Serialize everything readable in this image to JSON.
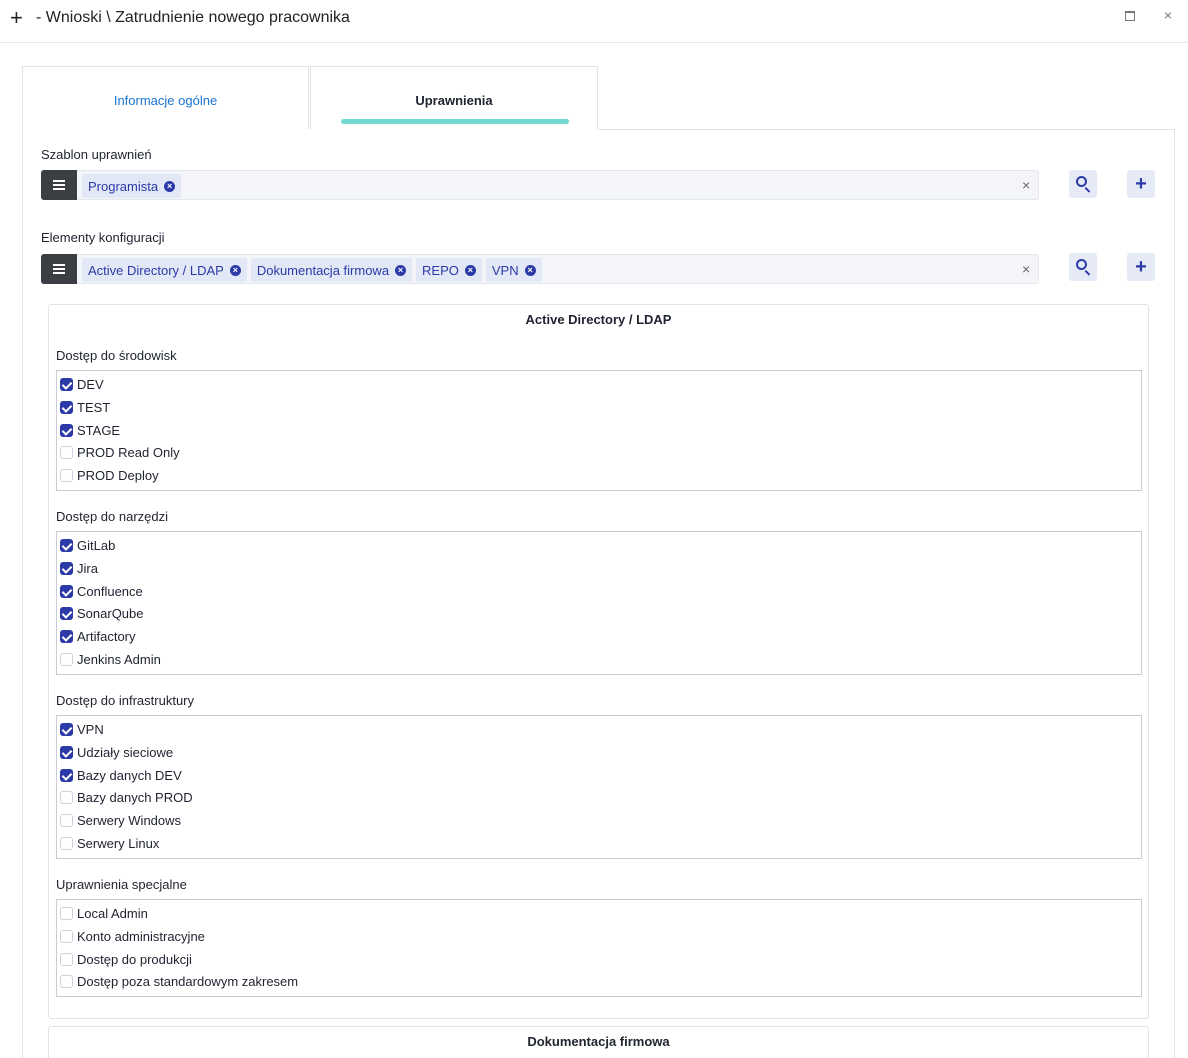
{
  "window": {
    "title": "- Wnioski \\ Zatrudnienie nowego pracownika",
    "plus_glyph": "+",
    "close_glyph": "×"
  },
  "tabs": [
    {
      "label": "Informacje ogólne",
      "active": false
    },
    {
      "label": "Uprawnienia",
      "active": true
    }
  ],
  "template_field": {
    "label": "Szablon uprawnień",
    "chips": [
      "Programista"
    ],
    "clear_glyph": "×"
  },
  "config_field": {
    "label": "Elementy konfiguracji",
    "chips": [
      "Active Directory / LDAP",
      "Dokumentacja firmowa",
      "REPO",
      "VPN"
    ],
    "clear_glyph": "×"
  },
  "button_glyphs": {
    "add": "+",
    "chip_remove": "×"
  },
  "sections": [
    {
      "title": "Active Directory / LDAP",
      "groups": [
        {
          "title": "Dostęp do środowisk",
          "items": [
            {
              "label": "DEV",
              "checked": true
            },
            {
              "label": "TEST",
              "checked": true
            },
            {
              "label": "STAGE",
              "checked": true
            },
            {
              "label": "PROD Read Only",
              "checked": false
            },
            {
              "label": "PROD Deploy",
              "checked": false
            }
          ]
        },
        {
          "title": "Dostęp do narzędzi",
          "items": [
            {
              "label": "GitLab",
              "checked": true
            },
            {
              "label": "Jira",
              "checked": true
            },
            {
              "label": "Confluence",
              "checked": true
            },
            {
              "label": "SonarQube",
              "checked": true
            },
            {
              "label": "Artifactory",
              "checked": true
            },
            {
              "label": "Jenkins Admin",
              "checked": false
            }
          ]
        },
        {
          "title": "Dostęp do infrastruktury",
          "items": [
            {
              "label": "VPN",
              "checked": true
            },
            {
              "label": "Udziały sieciowe",
              "checked": true
            },
            {
              "label": "Bazy danych DEV",
              "checked": true
            },
            {
              "label": "Bazy danych PROD",
              "checked": false
            },
            {
              "label": "Serwery Windows",
              "checked": false
            },
            {
              "label": "Serwery Linux",
              "checked": false
            }
          ]
        },
        {
          "title": "Uprawnienia specjalne",
          "items": [
            {
              "label": "Local Admin",
              "checked": false
            },
            {
              "label": "Konto administracyjne",
              "checked": false
            },
            {
              "label": "Dostęp do produkcji",
              "checked": false
            },
            {
              "label": "Dostęp poza standardowym zakresem",
              "checked": false
            }
          ]
        }
      ]
    },
    {
      "title": "Dokumentacja firmowa",
      "groups": []
    }
  ],
  "colors": {
    "accent": "#2c3aa8",
    "tab_indicator": "#72d9d2",
    "link": "#1c74d4"
  }
}
